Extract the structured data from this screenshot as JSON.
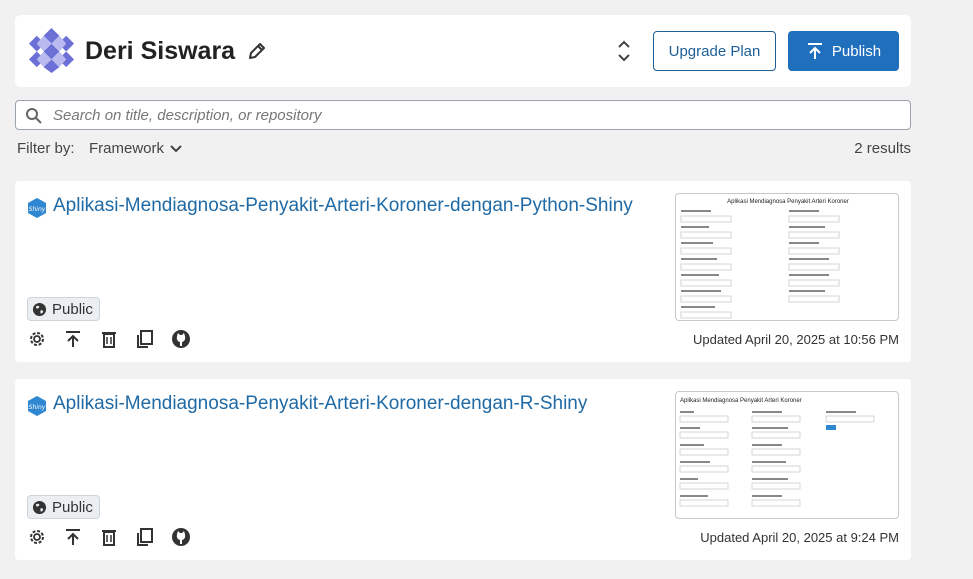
{
  "header": {
    "user_name": "Deri Siswara",
    "upgrade_label": "Upgrade Plan",
    "publish_label": "Publish"
  },
  "search": {
    "placeholder": "Search on title, description, or repository",
    "value": ""
  },
  "filter": {
    "label": "Filter by:",
    "dropdown_label": "Framework",
    "results": "2 results"
  },
  "colors": {
    "accent": "#1f6fbd",
    "link": "#1f6aa5",
    "avatar": "#6b6fd6"
  },
  "cards": [
    {
      "title": "Aplikasi-Mendiagnosa-Penyakit-Arteri-Koroner-dengan-Python-Shiny",
      "visibility": "Public",
      "updated": "Updated April 20, 2025 at 10:56 PM",
      "thumb_title": "Aplikasi Mendiagnosa Penyakit Arteri Koroner",
      "icons": [
        "settings-icon",
        "publish-icon",
        "delete-icon",
        "copy-icon",
        "github-icon"
      ]
    },
    {
      "title": "Aplikasi-Mendiagnosa-Penyakit-Arteri-Koroner-dengan-R-Shiny",
      "visibility": "Public",
      "updated": "Updated April 20, 2025 at 9:24 PM",
      "thumb_title": "Aplikasi Mendiagnosa Penyakit Arteri Koroner",
      "icons": [
        "settings-icon",
        "publish-icon",
        "delete-icon",
        "copy-icon",
        "github-icon"
      ]
    }
  ]
}
